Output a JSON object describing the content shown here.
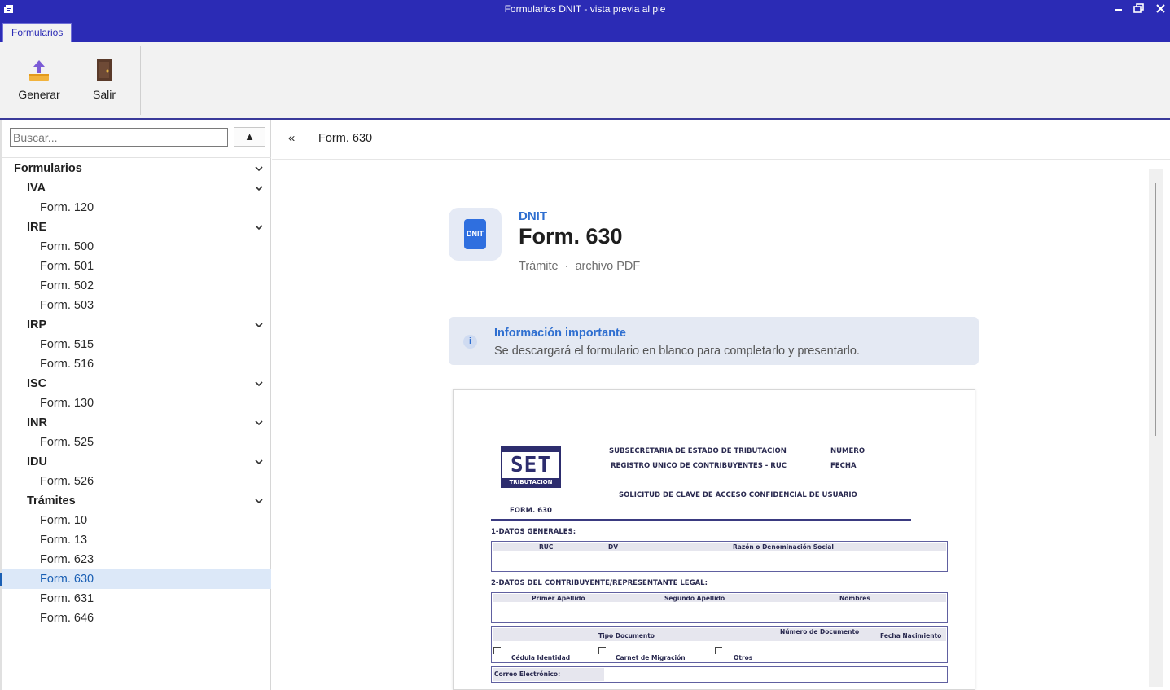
{
  "window": {
    "title": "Formularios DNIT - vista previa al pie"
  },
  "ribbon": {
    "tab_label": "Formularios",
    "generate_label": "Generar",
    "exit_label": "Salir"
  },
  "sidebar": {
    "search_placeholder": "Buscar...",
    "collapse_symbol": "▲",
    "root": "Formularios",
    "groups": [
      {
        "label": "IVA",
        "items": [
          "Form. 120"
        ]
      },
      {
        "label": "IRE",
        "items": [
          "Form. 500",
          "Form. 501",
          "Form. 502",
          "Form. 503"
        ]
      },
      {
        "label": "IRP",
        "items": [
          "Form. 515",
          "Form. 516"
        ]
      },
      {
        "label": "ISC",
        "items": [
          "Form. 130"
        ]
      },
      {
        "label": "INR",
        "items": [
          "Form. 525"
        ]
      },
      {
        "label": "IDU",
        "items": [
          "Form. 526"
        ]
      },
      {
        "label": "Trámites",
        "items": [
          "Form. 10",
          "Form. 13",
          "Form. 623",
          "Form. 630",
          "Form. 631",
          "Form. 646"
        ]
      }
    ],
    "selected_item": "Form. 630"
  },
  "breadcrumb": {
    "back_symbol": "«",
    "current": "Form. 630"
  },
  "detail": {
    "badge_text": "DNIT",
    "org": "DNIT",
    "title": "Form. 630",
    "type": "Trámite",
    "separator": "·",
    "format": "archivo PDF",
    "info_title": "Información importante",
    "info_text": "Se descargará el formulario en blanco para completarlo y presentarlo.",
    "info_icon": "i"
  },
  "preview": {
    "logo_text": "SET",
    "logo_sub": "TRIBUTACION",
    "header_line1": "SUBSECRETARIA DE ESTADO DE TRIBUTACION",
    "header_line2": "REGISTRO UNICO DE CONTRIBUYENTES - RUC",
    "numero": "NUMERO",
    "fecha": "FECHA",
    "request_title": "SOLICITUD DE CLAVE DE ACCESO CONFIDENCIAL DE USUARIO",
    "form_code": "FORM. 630",
    "section1": "1-DATOS GENERALES:",
    "ruc": "RUC",
    "dv": "DV",
    "razon": "Razón o Denominación Social",
    "section2": "2-DATOS DEL CONTRIBUYENTE/REPRESENTANTE LEGAL:",
    "primer_apellido": "Primer Apellido",
    "segundo_apellido": "Segundo Apellido",
    "nombres": "Nombres",
    "tipo_documento": "Tipo Documento",
    "numero_documento": "Número de Documento",
    "fecha_nacimiento": "Fecha Nacimiento",
    "cedula": "Cédula Identidad",
    "carnet": "Carnet de Migración",
    "otros": "Otros",
    "correo": "Correo Electrónico:"
  },
  "colors": {
    "titlebar": "#2b2bb5",
    "accent": "#2f6fd0",
    "selection": "#dce8f8"
  }
}
